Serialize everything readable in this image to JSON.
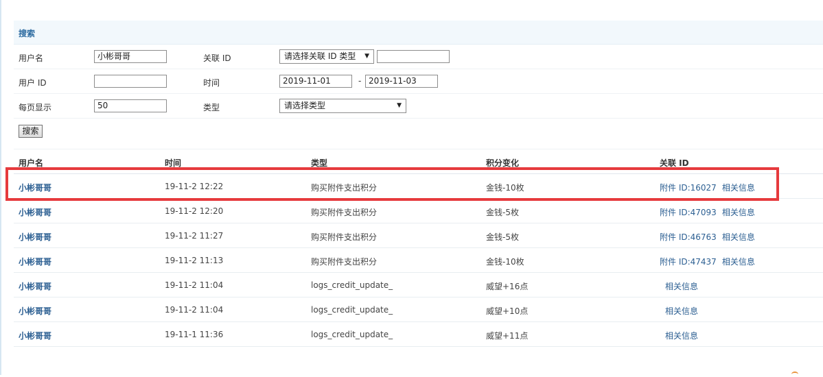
{
  "search": {
    "title": "搜索",
    "username_label": "用户名",
    "username_value": "小彬哥哥",
    "relation_label": "关联 ID",
    "relation_select": "请选择关联 ID 类型",
    "relation_value": "",
    "userid_label": "用户 ID",
    "userid_value": "",
    "time_label": "时间",
    "time_from": "2019-11-01",
    "time_sep": "-",
    "time_to": "2019-11-03",
    "perpage_label": "每页显示",
    "perpage_value": "50",
    "type_label": "类型",
    "type_select": "请选择类型",
    "submit_label": "搜索"
  },
  "table": {
    "headers": [
      "用户名",
      "时间",
      "类型",
      "积分变化",
      "关联 ID"
    ],
    "rows": [
      {
        "user": "小彬哥哥",
        "time": "19-11-2 12:22",
        "type": "购买附件支出积分",
        "credit": "金钱-10枚",
        "rel": "附件 ID:16027",
        "info": "相关信息"
      },
      {
        "user": "小彬哥哥",
        "time": "19-11-2 12:20",
        "type": "购买附件支出积分",
        "credit": "金钱-5枚",
        "rel": "附件 ID:47093",
        "info": "相关信息"
      },
      {
        "user": "小彬哥哥",
        "time": "19-11-2 11:27",
        "type": "购买附件支出积分",
        "credit": "金钱-5枚",
        "rel": "附件 ID:46763",
        "info": "相关信息"
      },
      {
        "user": "小彬哥哥",
        "time": "19-11-2 11:13",
        "type": "购买附件支出积分",
        "credit": "金钱-10枚",
        "rel": "附件 ID:47437",
        "info": "相关信息"
      },
      {
        "user": "小彬哥哥",
        "time": "19-11-2 11:04",
        "type": "logs_credit_update_",
        "credit": "威望+16点",
        "rel": "",
        "info": "相关信息"
      },
      {
        "user": "小彬哥哥",
        "time": "19-11-2 11:04",
        "type": "logs_credit_update_",
        "credit": "威望+10点",
        "rel": "",
        "info": "相关信息"
      },
      {
        "user": "小彬哥哥",
        "time": "19-11-1 11:36",
        "type": "logs_credit_update_",
        "credit": "威望+11点",
        "rel": "",
        "info": "相关信息"
      }
    ]
  },
  "colors": {
    "highlight": "#e63a3d",
    "link": "#2c5f92",
    "header_bg": "#f2f8fc"
  }
}
